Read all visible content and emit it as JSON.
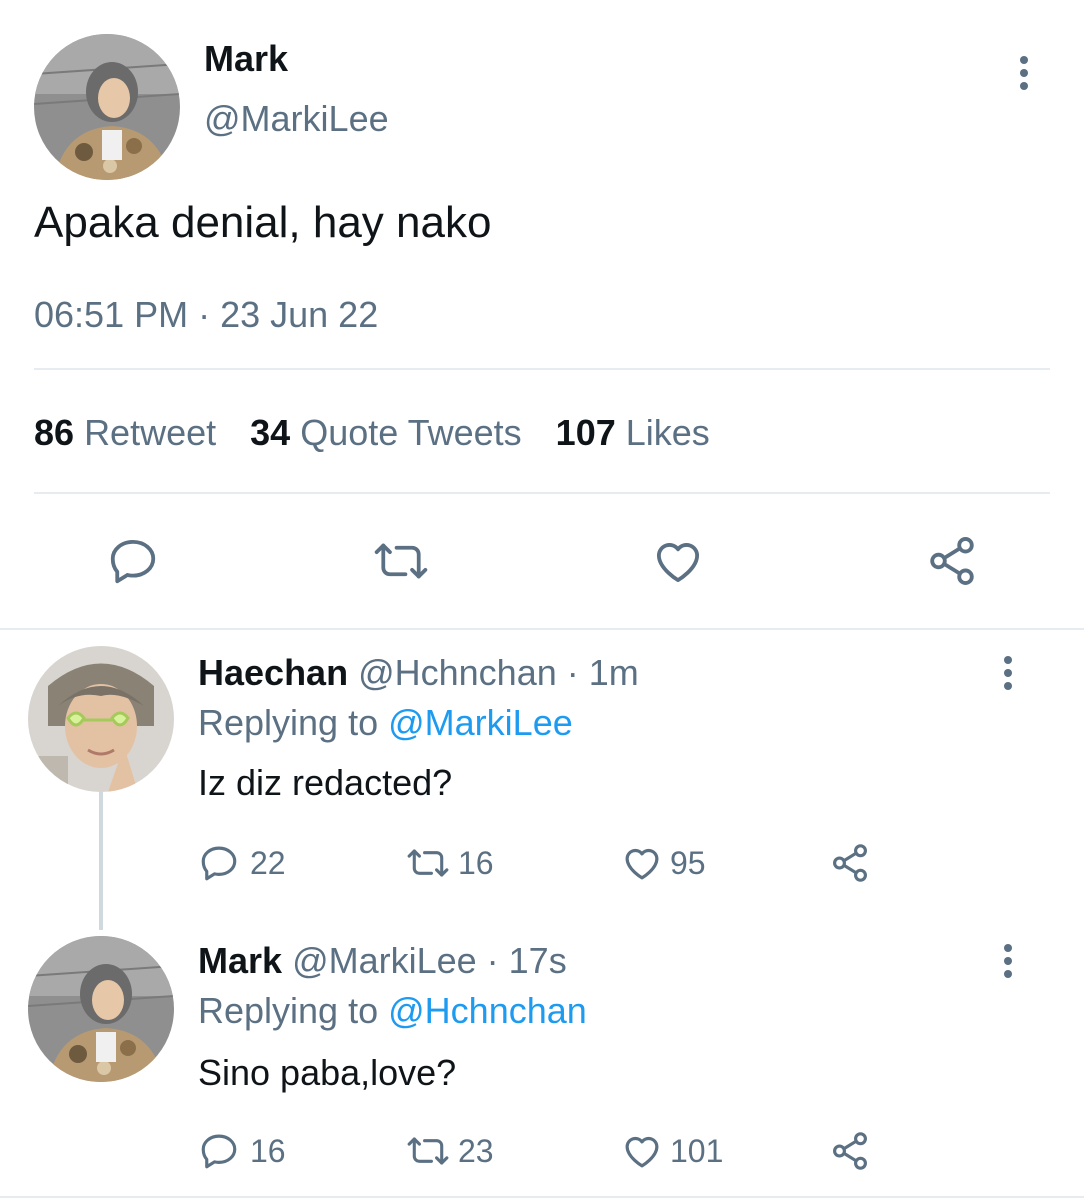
{
  "tweet": {
    "author_name": "Mark",
    "author_handle": "@MarkiLee",
    "text": "Apaka denial, hay nako",
    "timestamp": "06:51 PM · 23 Jun 22",
    "stats": [
      {
        "count": "86",
        "label": "Retweet"
      },
      {
        "count": "34",
        "label": "Quote Tweets"
      },
      {
        "count": "107",
        "label": "Likes"
      }
    ]
  },
  "replies": [
    {
      "name": "Haechan",
      "meta": "@Hchnchan · 1m",
      "replying_prefix": "Replying to",
      "replying_to": "@MarkiLee",
      "text": "Iz diz redacted?",
      "reply_count": "22",
      "retweet_count": "16",
      "like_count": "95"
    },
    {
      "name": "Mark",
      "meta": "@MarkiLee · 17s",
      "replying_prefix": "Replying to",
      "replying_to": "@Hchnchan",
      "text": "Sino paba,love?",
      "reply_count": "16",
      "retweet_count": "23",
      "like_count": "101"
    }
  ],
  "icons": [
    "reply-icon",
    "retweet-icon",
    "like-icon",
    "share-icon",
    "more-options-icon"
  ],
  "colors": {
    "link": "#1d9bf0",
    "muted": "#5b7083",
    "text": "#0f1419",
    "divider": "#e6ecf0"
  }
}
